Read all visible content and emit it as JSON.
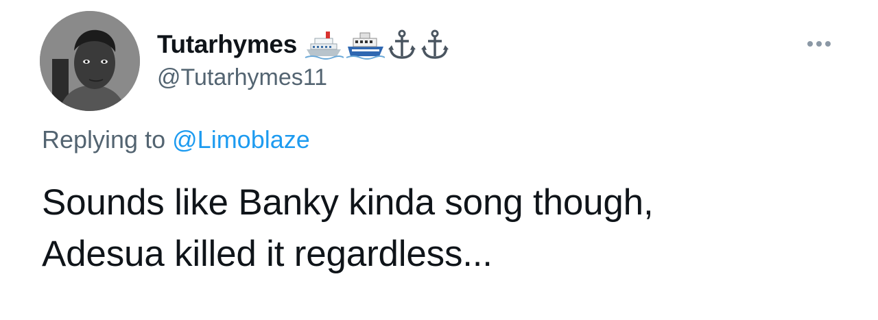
{
  "tweet": {
    "display_name": "Tutarhymes",
    "name_emojis": [
      "cruise-ship-icon",
      "ferry-icon",
      "anchor-icon",
      "anchor-icon"
    ],
    "handle": "@Tutarhymes11",
    "replying_prefix": "Replying to",
    "replying_to": "@Limoblaze",
    "text_lines": [
      "Sounds like Banky kinda song though,",
      "Adesua killed it regardless..."
    ]
  },
  "colors": {
    "text_primary": "#0f1419",
    "text_secondary": "#536471",
    "link": "#1d9bf0"
  }
}
